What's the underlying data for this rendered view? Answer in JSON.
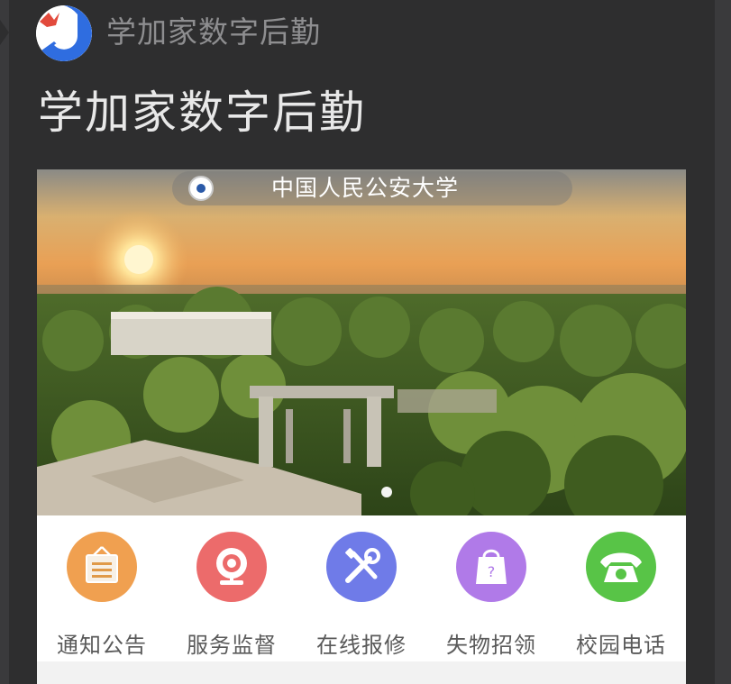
{
  "app": {
    "name": "学加家数字后勤"
  },
  "page": {
    "title": "学加家数字后勤"
  },
  "banner": {
    "school_name": "中国人民公安大学",
    "active_slide": 1,
    "slide_count": 1
  },
  "menu": {
    "items": [
      {
        "label": "通知公告",
        "icon": "notice-board-icon",
        "color": "#f0a050"
      },
      {
        "label": "服务监督",
        "icon": "camera-icon",
        "color": "#ec6b6b"
      },
      {
        "label": "在线报修",
        "icon": "tools-icon",
        "color": "#6f7be8"
      },
      {
        "label": "失物招领",
        "icon": "shopping-bag-icon",
        "color": "#b07ae8"
      },
      {
        "label": "校园电话",
        "icon": "telephone-icon",
        "color": "#58c447"
      }
    ]
  },
  "colors": {
    "background": "#2e2e2f",
    "title_text": "#e8e8e8",
    "app_name_text": "#8e8e90",
    "logo_blue": "#2f6de0",
    "logo_red": "#e24a3c"
  }
}
